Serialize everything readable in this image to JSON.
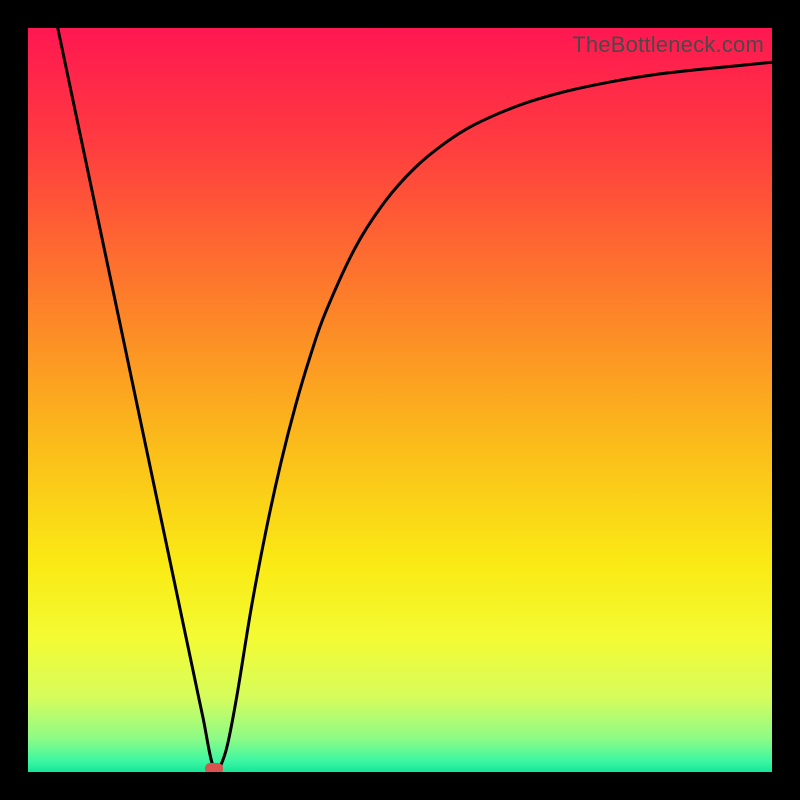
{
  "watermark": "TheBottleneck.com",
  "chart_data": {
    "type": "line",
    "title": "",
    "xlabel": "",
    "ylabel": "",
    "xlim": [
      0,
      100
    ],
    "ylim": [
      0,
      100
    ],
    "grid": false,
    "legend": false,
    "minimum_marker": {
      "x": 25,
      "y": 0,
      "color": "#d9534f"
    },
    "background_gradient": {
      "stops": [
        {
          "offset": 0.0,
          "color": "#ff1751"
        },
        {
          "offset": 0.16,
          "color": "#ff3d3f"
        },
        {
          "offset": 0.35,
          "color": "#fd7a2b"
        },
        {
          "offset": 0.55,
          "color": "#fbb91b"
        },
        {
          "offset": 0.72,
          "color": "#faea14"
        },
        {
          "offset": 0.82,
          "color": "#f3fb33"
        },
        {
          "offset": 0.9,
          "color": "#d6fc5c"
        },
        {
          "offset": 0.955,
          "color": "#8dfb86"
        },
        {
          "offset": 0.985,
          "color": "#3df7a2"
        },
        {
          "offset": 1.0,
          "color": "#14e698"
        }
      ]
    },
    "series": [
      {
        "name": "bottleneck-curve",
        "color": "#000000",
        "x": [
          4,
          6,
          8,
          10,
          12,
          14,
          16,
          18,
          20,
          22,
          23.5,
          25,
          26.5,
          28,
          30,
          32,
          34,
          36,
          38,
          40,
          44,
          48,
          52,
          56,
          60,
          66,
          72,
          78,
          84,
          90,
          96,
          100
        ],
        "y": [
          100,
          90.5,
          81,
          71.5,
          62,
          52.5,
          43,
          33.5,
          24,
          14.5,
          7.4,
          0.5,
          2.5,
          9.8,
          22,
          32.5,
          41.6,
          49.4,
          56.1,
          61.8,
          70.5,
          76.7,
          81.2,
          84.5,
          87,
          89.6,
          91.4,
          92.7,
          93.7,
          94.4,
          95,
          95.4
        ]
      }
    ]
  }
}
